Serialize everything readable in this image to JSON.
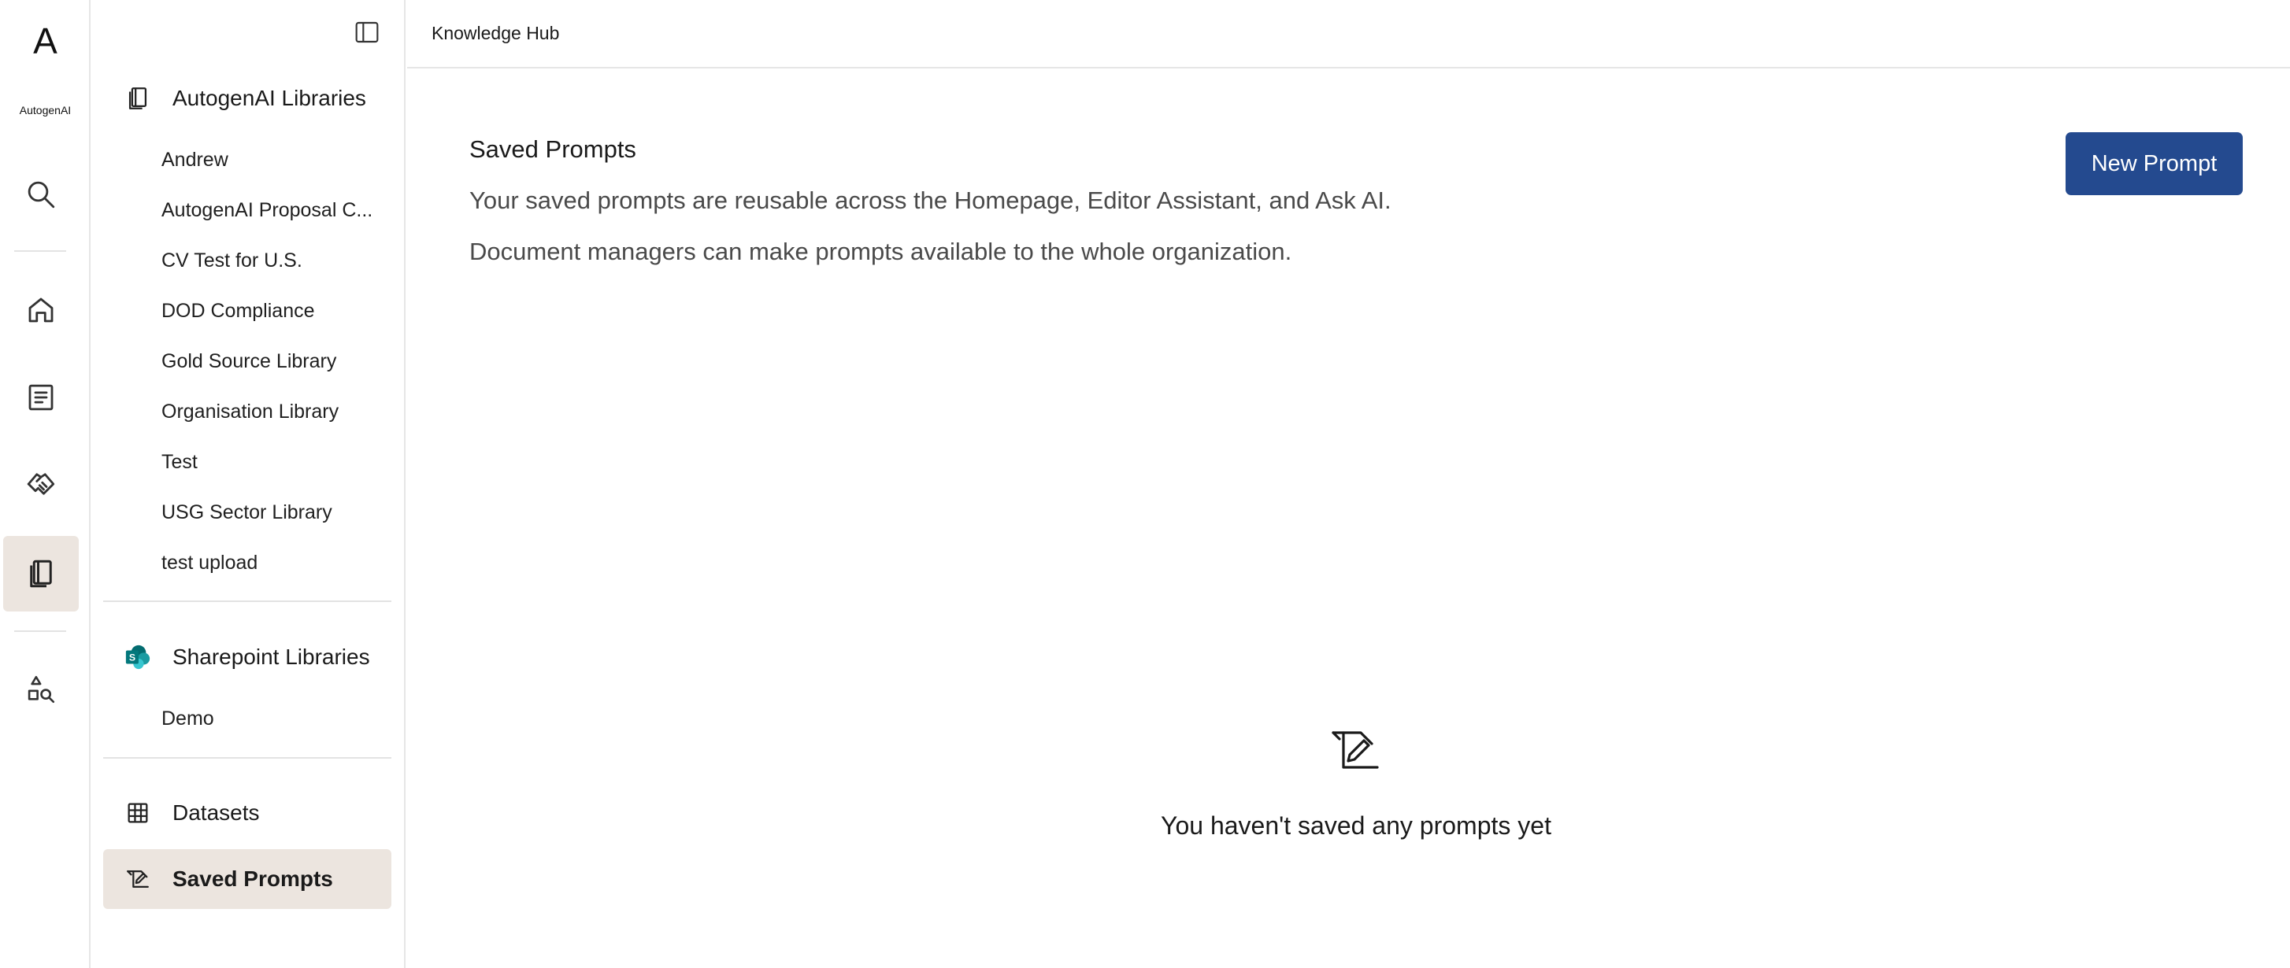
{
  "rail": {
    "brand_logo": "A",
    "brand_name": "AutogenAI",
    "icons": [
      "search-icon",
      "home-icon",
      "document-icon",
      "handshake-icon",
      "library-icon",
      "shapes-search-icon"
    ],
    "active": "library-icon"
  },
  "sidebar": {
    "autogen_section": {
      "label": "AutogenAI Libraries",
      "icon": "book-icon"
    },
    "autogen_items": [
      "Andrew",
      "AutogenAI Proposal C...",
      "CV Test for U.S.",
      "DOD Compliance",
      "Gold Source Library",
      "Organisation Library",
      "Test",
      "USG Sector Library",
      "test upload"
    ],
    "sharepoint_section": {
      "label": "Sharepoint Libraries",
      "icon": "sharepoint-icon"
    },
    "sharepoint_items": [
      "Demo"
    ],
    "datasets": {
      "label": "Datasets",
      "icon": "table-icon"
    },
    "saved_prompts": {
      "label": "Saved Prompts",
      "icon": "prompt-icon",
      "active": true
    }
  },
  "header": {
    "title": "Knowledge Hub"
  },
  "main": {
    "title": "Saved Prompts",
    "description_line1": "Your saved prompts are reusable across the Homepage, Editor Assistant, and Ask AI.",
    "description_line2": "Document managers can make prompts available to the whole organization.",
    "new_prompt_label": "New Prompt",
    "empty_state_text": "You haven't saved any prompts yet"
  },
  "colors": {
    "accent": "#244a8f",
    "active_bg": "#ece5df",
    "sharepoint_teal": "#036c70"
  }
}
